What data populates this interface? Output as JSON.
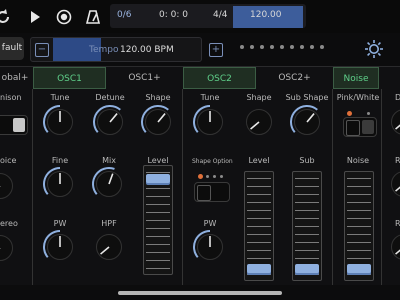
{
  "transport": {
    "loop_icon": "loop-icon",
    "play_icon": "play-icon",
    "record_icon": "record-icon",
    "metronome_icon": "metronome-icon",
    "bar_position": "0/6",
    "time": "0: 0: 0",
    "time_signature": "4/4",
    "bpm": "120.00"
  },
  "preset": {
    "name": "fault",
    "minus_label": "−",
    "plus_label": "+",
    "tempo_label": "Tempo",
    "tempo_value": "120.00 BPM",
    "tempo_level": 0.28,
    "settings_icon": "sun-gear-icon"
  },
  "tabs": [
    {
      "label": "obal+",
      "active": false
    },
    {
      "label": "OSC1",
      "active": true
    },
    {
      "label": "OSC1+",
      "active": false
    },
    {
      "label": "OSC2",
      "active": true
    },
    {
      "label": "OSC2+",
      "active": false
    },
    {
      "label": "Noise",
      "active": true
    }
  ],
  "global": {
    "unison_label": "nison",
    "voice_label": "oice",
    "stereo_label": "ereo"
  },
  "osc1": {
    "tune_label": "Tune",
    "detune_label": "Detune",
    "shape_label": "Shape",
    "fine_label": "Fine",
    "mix_label": "Mix",
    "level_label": "Level",
    "pw_label": "PW",
    "hpf_label": "HPF",
    "level_value": 0.92
  },
  "osc2": {
    "tune_label": "Tune",
    "shape_label": "Shape",
    "sub_shape_label": "Sub Shape",
    "shape_option_label": "Shape Option",
    "level_label": "Level",
    "sub_label": "Sub",
    "pw_label": "PW",
    "level_value": 0.04,
    "sub_value": 0.04
  },
  "noise": {
    "pink_white_label": "Pink/White",
    "noise_label": "Noise",
    "level_value": 0.04,
    "partial_label_1": "D",
    "partial_label_2": "R",
    "partial_label_3": "R"
  }
}
